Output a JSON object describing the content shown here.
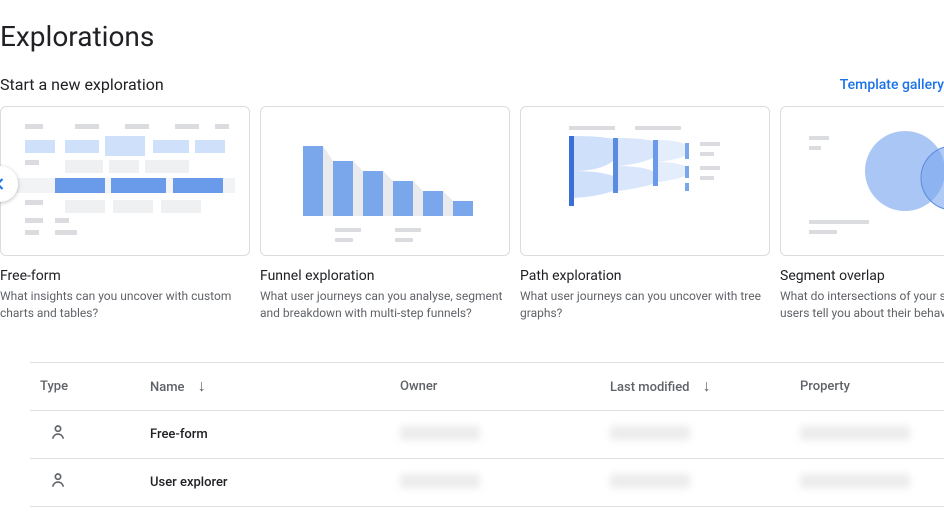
{
  "page_title": "Explorations",
  "subheader": {
    "title": "Start a new exploration",
    "link": "Template gallery"
  },
  "cards": [
    {
      "title": "Free-form",
      "desc": "What insights can you uncover with custom charts and tables?"
    },
    {
      "title": "Funnel exploration",
      "desc": "What user journeys can you analyse, segment and breakdown with multi-step funnels?"
    },
    {
      "title": "Path exploration",
      "desc": "What user journeys can you uncover with tree graphs?"
    },
    {
      "title": "Segment overlap",
      "desc": "What do intersections of your segments of users tell you about their behaviour?"
    }
  ],
  "table": {
    "headers": {
      "type": "Type",
      "name": "Name",
      "owner": "Owner",
      "modified": "Last modified",
      "property": "Property"
    },
    "rows": [
      {
        "name": "Free-form"
      },
      {
        "name": "User explorer"
      }
    ]
  }
}
